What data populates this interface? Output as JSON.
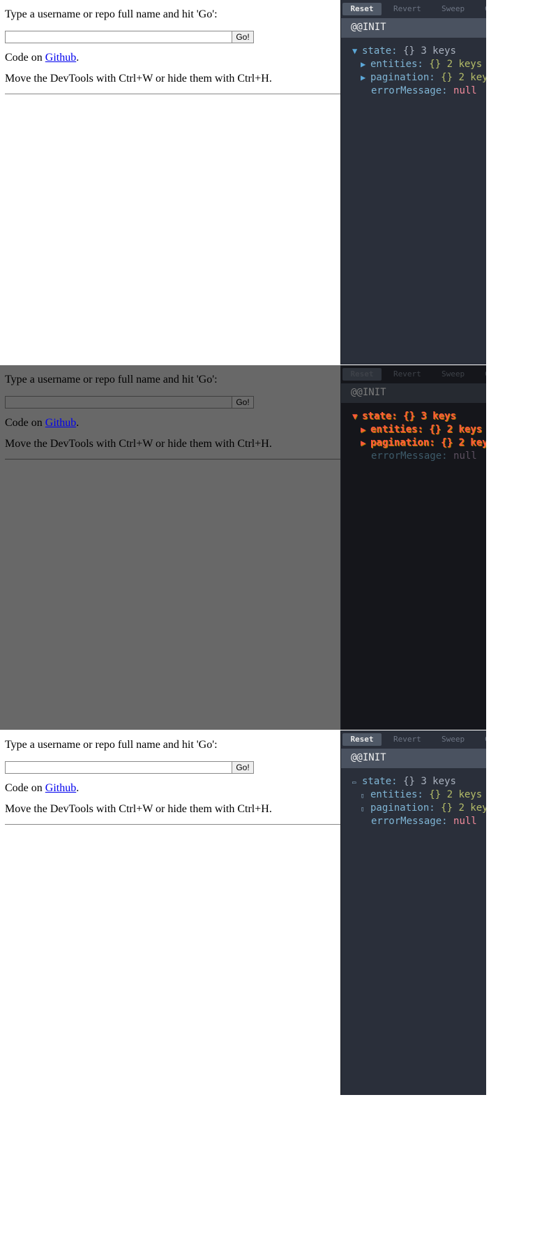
{
  "app": {
    "prompt": "Type a username or repo full name and hit 'Go':",
    "search_value": "",
    "go_label": "Go!",
    "code_prefix": "Code on ",
    "github_link": "Github",
    "code_suffix": ".",
    "devtools_hint": "Move the DevTools with Ctrl+W or hide them with Ctrl+H."
  },
  "devtools": {
    "toolbar": {
      "reset": "Reset",
      "revert": "Revert",
      "sweep": "Sweep",
      "extra": "C"
    },
    "action": "@@INIT",
    "tree": {
      "state_key": "state:",
      "state_brace": "{}",
      "state_count": "3 keys",
      "entities_key": "entities:",
      "entities_brace": "{}",
      "entities_count": "2 keys",
      "pagination_key": "pagination:",
      "pagination_brace": "{}",
      "pagination_count": "2 keys",
      "error_key": "errorMessage:",
      "error_value": "null"
    },
    "arrows": {
      "expanded": "▼",
      "collapsed": "▶",
      "minus": "▭",
      "box": "▯"
    }
  }
}
